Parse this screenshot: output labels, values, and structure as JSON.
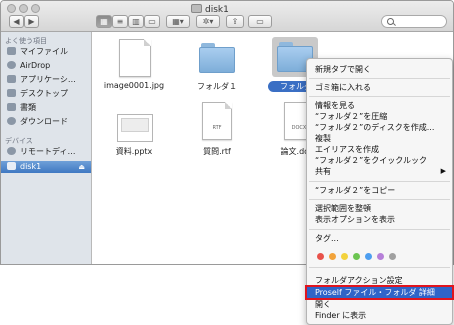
{
  "window": {
    "title": "disk1"
  },
  "sidebar": {
    "favorites_heading": "よく使う項目",
    "favorites": [
      {
        "label": "マイファイル",
        "icon": "all-files-icon"
      },
      {
        "label": "AirDrop",
        "icon": "airdrop-icon"
      },
      {
        "label": "アプリケーシ…",
        "icon": "applications-icon"
      },
      {
        "label": "デスクトップ",
        "icon": "desktop-icon"
      },
      {
        "label": "書類",
        "icon": "documents-icon"
      },
      {
        "label": "ダウンロード",
        "icon": "downloads-icon"
      }
    ],
    "devices_heading": "デバイス",
    "devices": [
      {
        "label": "リモートディ…",
        "icon": "remote-disc-icon"
      },
      {
        "label": "disk1",
        "icon": "disk-icon",
        "eject": "⏏"
      }
    ]
  },
  "files": [
    {
      "name": "image0001.jpg",
      "kind": "image"
    },
    {
      "name": "フォルダ１",
      "kind": "folder"
    },
    {
      "name": "フォルダ",
      "kind": "folder",
      "selected": true
    },
    {
      "name": "資料.pptx",
      "kind": "slide"
    },
    {
      "name": "質問.rtf",
      "kind": "document",
      "ext": "RTF"
    },
    {
      "name": "論文.doc",
      "kind": "document",
      "ext": "DOCX"
    }
  ],
  "context_menu": {
    "items": [
      "新規タブで開く",
      "ゴミ箱に入れる",
      "情報を見る",
      "“フォルダ２”を圧縮",
      "“フォルダ２”のディスクを作成...",
      "複製",
      "エイリアスを作成",
      "“フォルダ２”をクイックルック",
      "共有",
      "“フォルダ２”をコピー",
      "選択範囲を整頓",
      "表示オプションを表示",
      "タグ...",
      "フォルダアクション設定",
      "Proself ファイル・フォルダ 詳細",
      "開く",
      "Finder に表示"
    ],
    "share_arrow": "▶",
    "tag_colors": [
      "#e8524a",
      "#f2a33a",
      "#f3d23c",
      "#6cc551",
      "#4d9ef0",
      "#b67fd8",
      "#a0a0a0"
    ],
    "highlighted_item": "Proself ファイル・フォルダ 詳細",
    "highlight_outline_color": "#e0141e"
  }
}
